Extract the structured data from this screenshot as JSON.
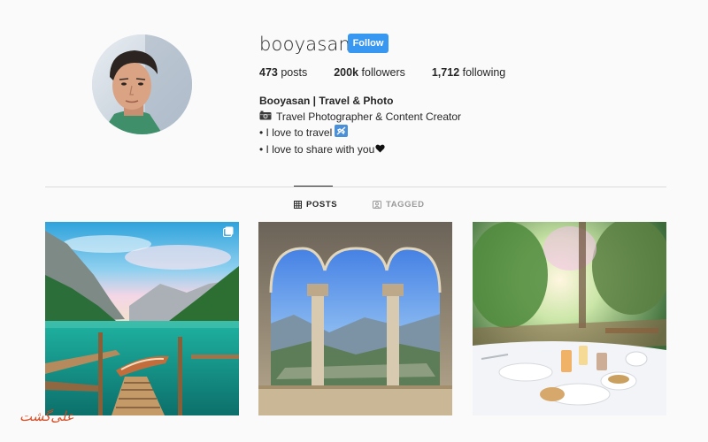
{
  "profile": {
    "username": "booyasan",
    "follow_label": "Follow",
    "stats": {
      "posts_count": "473",
      "posts_label": "posts",
      "followers_count": "200k",
      "followers_label": "followers",
      "following_count": "1,712",
      "following_label": "following"
    },
    "bio": {
      "name": "Booyasan | Travel & Photo",
      "line1": "Travel Photographer & Content Creator",
      "line2": "• I love to travel",
      "line3": "• I love to share with you"
    }
  },
  "tabs": [
    {
      "label": "POSTS",
      "icon": "grid-icon",
      "active": true
    },
    {
      "label": "TAGGED",
      "icon": "tag-icon",
      "active": false
    }
  ],
  "posts": [
    {
      "subject": "mountain lake with wooden boat and pier",
      "icon": "carousel-icon"
    },
    {
      "subject": "stone arches overlooking valley"
    },
    {
      "subject": "garden breakfast table in sunlight"
    }
  ],
  "watermark": "علی‌گشت",
  "colors": {
    "accent": "#3897f0",
    "watermark": "#d7471d",
    "divider": "#dbdbdb"
  }
}
